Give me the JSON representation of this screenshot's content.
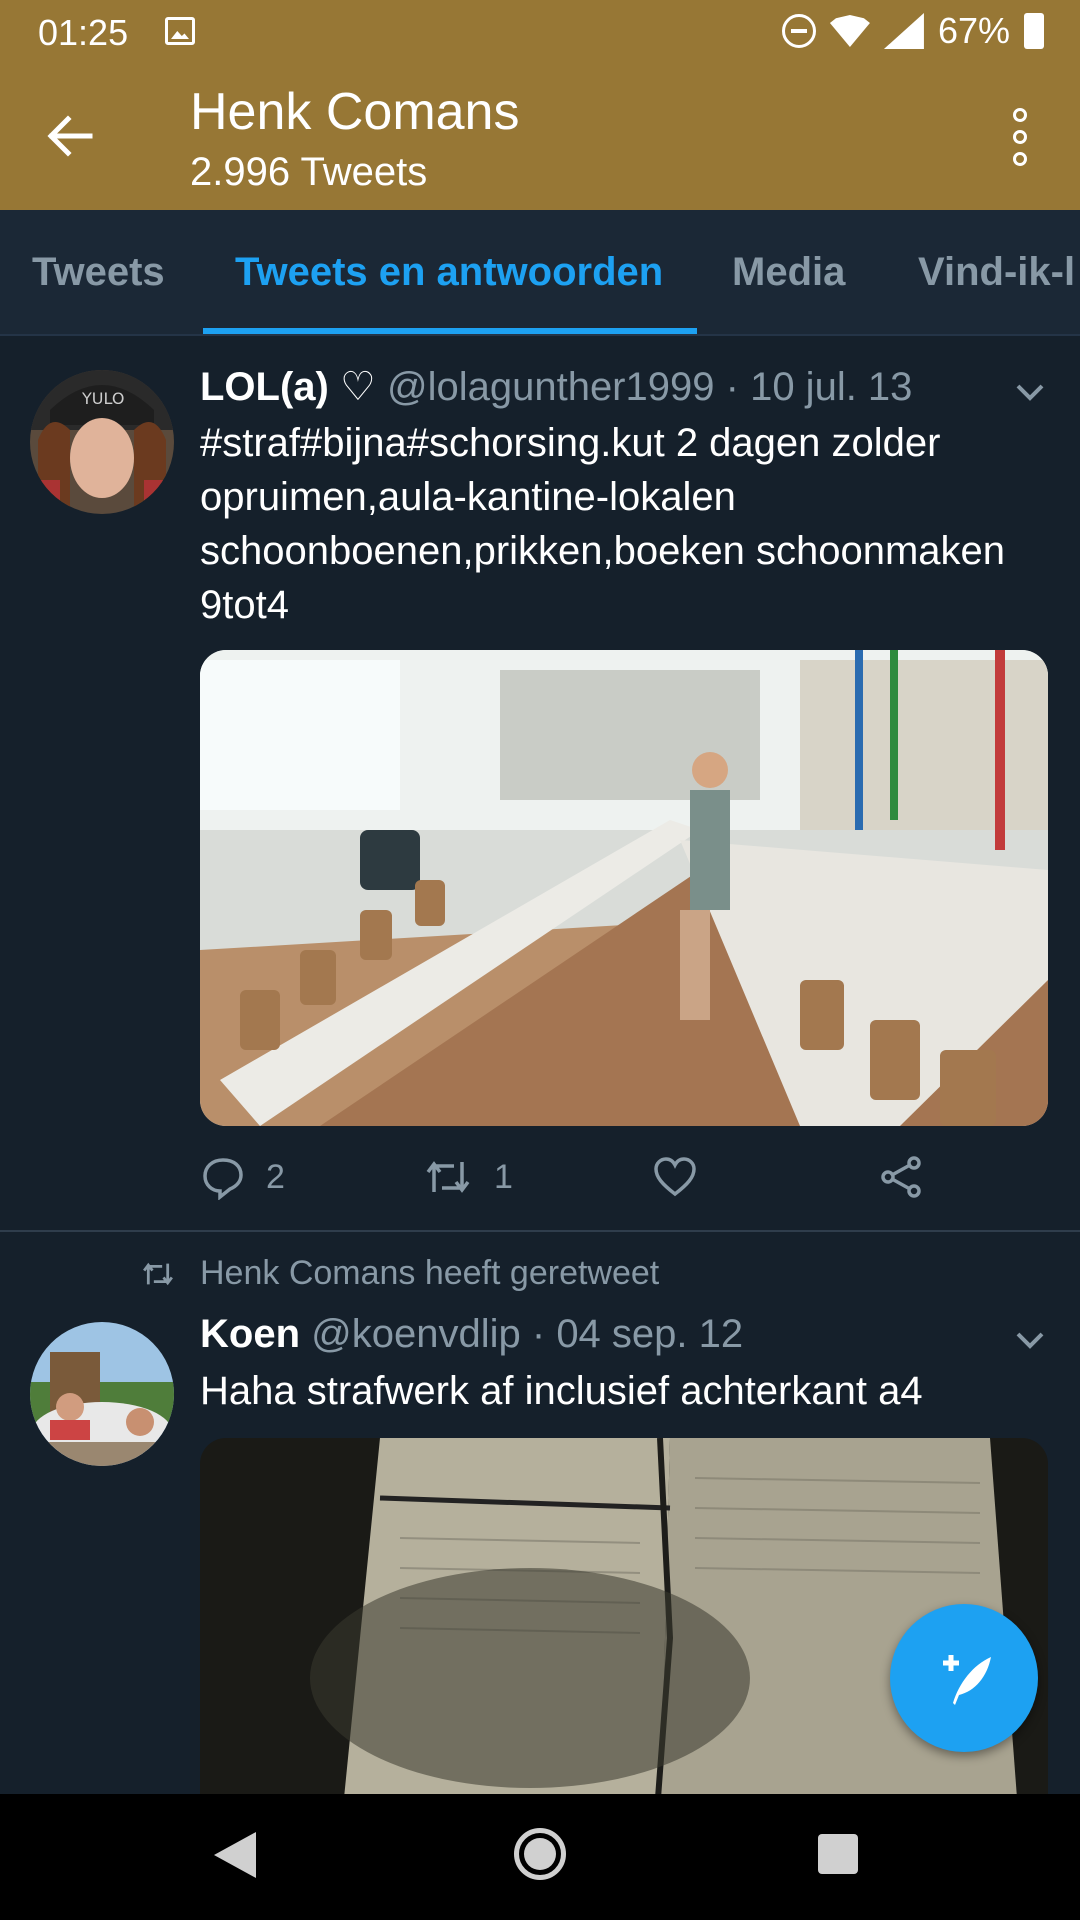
{
  "status_bar": {
    "time": "01:25",
    "battery": "67%",
    "icons": [
      "image-icon",
      "dnd-icon",
      "wifi-icon",
      "signal-icon",
      "battery-icon"
    ]
  },
  "header": {
    "title": "Henk Comans",
    "subtitle": "2.996 Tweets",
    "bg_color": "#977735"
  },
  "tabs": [
    {
      "label": "Tweets",
      "active": false
    },
    {
      "label": "Tweets en antwoorden",
      "active": true
    },
    {
      "label": "Media",
      "active": false
    },
    {
      "label": "Vind-ik-l",
      "active": false
    }
  ],
  "faded_retweet_label": "Henk Comans heeft geretweet",
  "tweets": [
    {
      "name": "LOL(a) ♡",
      "handle": "@lolagunther1999",
      "separator": "·",
      "date": "10 jul. 13",
      "text": "#straf#bijna#schorsing.kut 2 dagen zolder opruimen,aula-kantine-lokalen schoonboenen,prikken,boeken schoonmaken 9tot4",
      "replies": "2",
      "retweets": "1"
    },
    {
      "retweeted_by": "Henk Comans heeft geretweet",
      "name": "Koen",
      "handle": "@koenvdlip",
      "separator": "·",
      "date": "04 sep. 12",
      "text": "Haha strafwerk af inclusief achterkant a4"
    }
  ],
  "colors": {
    "background": "#15202b",
    "accent": "#1da1f2",
    "muted": "#8899a6"
  }
}
